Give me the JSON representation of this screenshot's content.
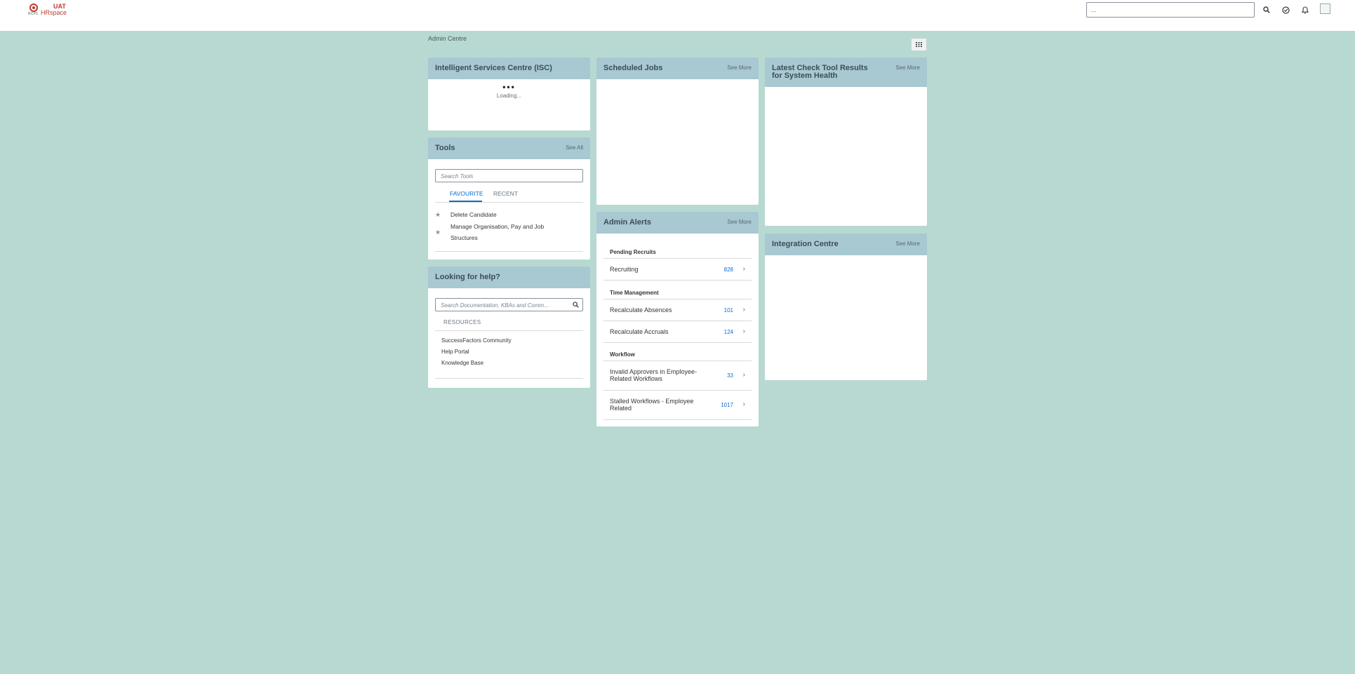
{
  "header": {
    "logo_org": "RCPL",
    "logo_env": "UAT",
    "logo_brand": "HRspace",
    "search_value": "...",
    "icons": [
      "search-icon",
      "approval-icon",
      "bell-icon",
      "user-avatar-icon"
    ]
  },
  "breadcrumb": "Admin Centre",
  "isc": {
    "title": "Intelligent Services Centre (ISC)",
    "loading_dots": "•••",
    "loading_text": "Loading..."
  },
  "tools": {
    "title": "Tools",
    "link": "See All",
    "search_placeholder": "Search Tools",
    "tabs": [
      "FAVOURITE",
      "RECENT"
    ],
    "favourites": [
      "Delete Candidate",
      "Manage Organisation, Pay and Job Structures"
    ]
  },
  "help": {
    "title": "Looking for help?",
    "search_placeholder": "Search Documentation, KBAs and Comm...",
    "resources_label": "RESOURCES",
    "links": [
      "SuccessFactors Community",
      "Help Portal",
      "Knowledge Base"
    ]
  },
  "scheduled_jobs": {
    "title": "Scheduled Jobs",
    "link": "See More"
  },
  "admin_alerts": {
    "title": "Admin Alerts",
    "link": "See More",
    "sections": [
      {
        "title": "Pending Recruits",
        "items": [
          {
            "label": "Recruiting",
            "count": "828"
          }
        ]
      },
      {
        "title": "Time Management",
        "items": [
          {
            "label": "Recalculate Absences",
            "count": "101"
          },
          {
            "label": "Recalculate Accruals",
            "count": "124"
          }
        ]
      },
      {
        "title": "Workflow",
        "items": [
          {
            "label": "Invalid Approvers in Employee-Related Workflows",
            "count": "33"
          },
          {
            "label": "Stalled Workflows - Employee Related",
            "count": "1017"
          }
        ]
      }
    ]
  },
  "check_tool": {
    "title": "Latest Check Tool Results for System Health",
    "link": "See More"
  },
  "integration": {
    "title": "Integration Centre",
    "link": "See More"
  },
  "colors": {
    "background": "#b7d9d2",
    "card_header": "#a8c8d2",
    "accent": "#0a6ed1"
  }
}
